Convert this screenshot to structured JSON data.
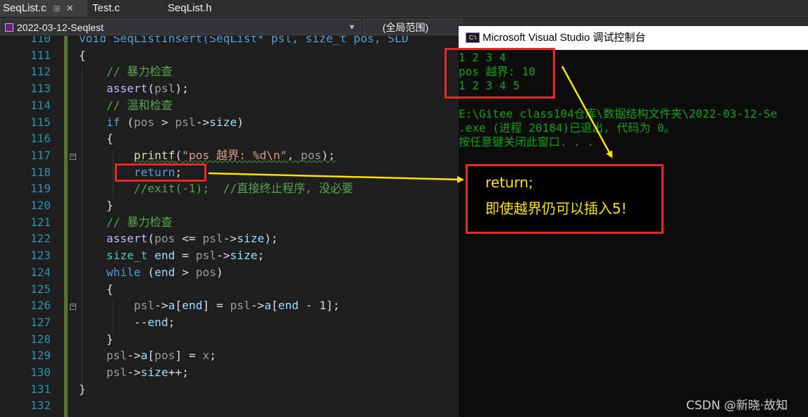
{
  "tabs": [
    {
      "label": "SeqList.c",
      "active": true
    },
    {
      "label": "Test.c",
      "active": false
    },
    {
      "label": "SeqList.h",
      "active": false
    }
  ],
  "nav": {
    "project": "2022-03-12-Seqlest",
    "scope": "(全局范围)"
  },
  "editor": {
    "line_numbers": [
      "110",
      "111",
      "112",
      "113",
      "114",
      "115",
      "116",
      "117",
      "118",
      "119",
      "120",
      "121",
      "122",
      "123",
      "124",
      "125",
      "126",
      "127",
      "128",
      "129",
      "130",
      "131",
      "132"
    ],
    "line_110": "void SeqListInsert(SeqList* psl, size_t pos, SLD",
    "comment_112": "// 暴力检查",
    "comment_114": "// 温和检查",
    "printf_format": "\"pos 越界: %d\\n\"",
    "return_stmt": "return",
    "comment_119": "//exit(-1);  //直接终止程序, 没必要",
    "comment_121": "// 暴力检查"
  },
  "console": {
    "title": "Microsoft Visual Studio 调试控制台",
    "icon_label": "C:\\",
    "lines": [
      "1 2 3 4",
      "pos 越界: 10",
      "1 2 3 4 5",
      "",
      "E:\\Gitee class104仓库\\数据结构文件夹\\2022-03-12-Se",
      ".exe (进程 20184)已退出, 代码为 0。",
      "按任意键关闭此窗口. . ."
    ]
  },
  "annotation": {
    "line1": "return;",
    "line2": "即使越界仍可以插入5!"
  },
  "watermark": "CSDN @新晓·故知",
  "colors": {
    "editor_bg": "#1e1e1e",
    "keyword": "#569cd6",
    "comment": "#57a64a",
    "line_number": "#2b91af",
    "console_text": "#13a10e",
    "annotation_red": "#e12b2b",
    "annotation_yellow": "#ffe200"
  }
}
